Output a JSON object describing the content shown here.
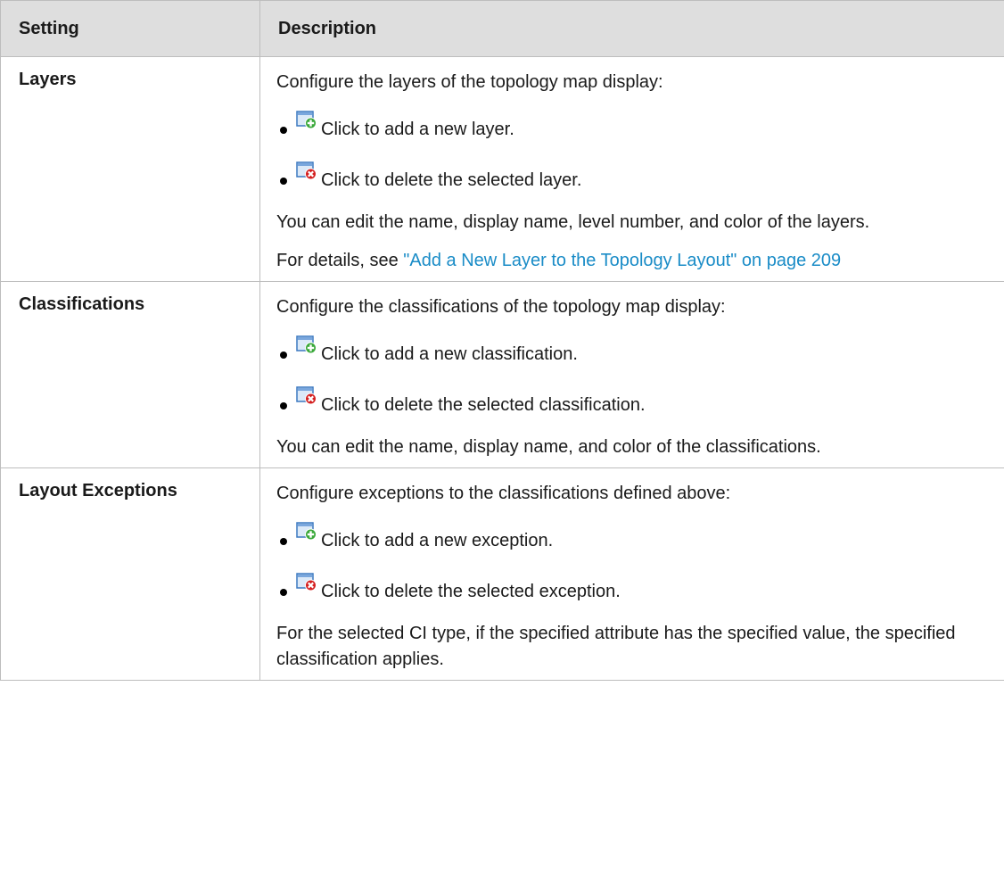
{
  "table": {
    "headers": {
      "setting": "Setting",
      "description": "Description"
    },
    "rows": [
      {
        "setting": "Layers",
        "intro": "Configure the layers of the topology map display:",
        "add_text": "Click to add a new layer.",
        "delete_text": "Click to delete the selected layer.",
        "note": "You can edit the name, display name, level number, and color of the layers.",
        "xref_prefix": "For details, see ",
        "xref_link": "\"Add a New Layer to the Topology Layout\" on page 209"
      },
      {
        "setting": "Classifications",
        "intro": "Configure the classifications of the topology map display:",
        "add_text": "Click to add a new classification.",
        "delete_text": "Click to delete the selected classification.",
        "note": "You can edit the name, display name, and color of the classifications."
      },
      {
        "setting": "Layout Exceptions",
        "intro": "Configure exceptions to the classifications defined above:",
        "add_text": "Click to add a new exception.",
        "delete_text": "Click to delete the selected exception.",
        "note": "For the selected CI type, if the specified attribute has the specified value, the specified classification applies."
      }
    ]
  },
  "icons": {
    "add": "add-icon",
    "delete": "delete-icon"
  },
  "colors": {
    "header_bg": "#dedede",
    "border": "#bdbdbd",
    "link": "#1a8cc7",
    "icon_frame": "#3b78c0",
    "icon_add": "#3aa83a",
    "icon_delete": "#d42020"
  }
}
